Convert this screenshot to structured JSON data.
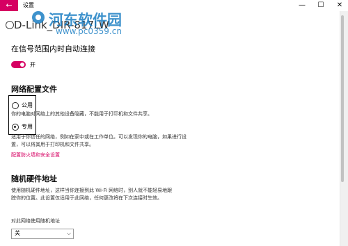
{
  "window": {
    "title": "设置",
    "back_icon": "←",
    "minimize_icon": "—",
    "maximize_icon": "☐",
    "close_icon": "✕"
  },
  "network": {
    "name": "D-Link_DIR-817LW"
  },
  "auto_connect": {
    "label": "在信号范围内时自动连接",
    "toggle_state": "开"
  },
  "network_profile": {
    "heading": "网络配置文件",
    "options": [
      {
        "label": "公用",
        "description": "你的电脑对网络上的其他设备隐藏，不能用于打印机和文件共享。",
        "checked": false
      },
      {
        "label": "专用",
        "description": "适用于你信任的网络，例如在家中或在工作单位。可以发现你的电脑，如果进行设置，可以将其用于打印机和文件共享。",
        "checked": true
      }
    ],
    "firewall_link": "配置防火墙和安全设置"
  },
  "random_hw": {
    "heading": "随机硬件地址",
    "description": "使用随机硬件地址，这样当你连接到此 Wi-Fi 网络时，别人就不能轻易地跟踪你的位置。此设置仅适用于此网络，任何更改将在下次连接时生效。",
    "dropdown_label": "对此网络使用随机地址",
    "dropdown_value": "关"
  },
  "watermark": {
    "title": "河东软件园",
    "url": "www.pc0359.cn"
  },
  "colors": {
    "accent": "#d60062",
    "watermark": "#1d7fc4"
  }
}
